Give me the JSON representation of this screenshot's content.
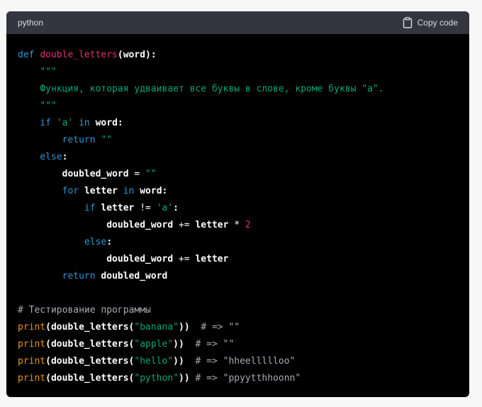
{
  "header": {
    "language": "python",
    "copy_label": "Copy code",
    "copy_icon": "clipboard-icon"
  },
  "colors": {
    "keyword": "#2e95d3",
    "function": "#df3079",
    "builtin": "#e9950c",
    "string": "#00a67d",
    "number": "#df3079",
    "comment": "#a9a9b3",
    "text": "#ffffff",
    "header_bg": "#343541",
    "code_bg": "#000000"
  },
  "code": {
    "lines": [
      [
        {
          "t": "kw",
          "v": "def"
        },
        {
          "t": "op",
          "v": " "
        },
        {
          "t": "fn",
          "v": "double_letters"
        },
        {
          "t": "id",
          "v": "(word):"
        }
      ],
      [
        {
          "t": "op",
          "v": "    "
        },
        {
          "t": "str",
          "v": "\"\"\""
        }
      ],
      [
        {
          "t": "op",
          "v": "    "
        },
        {
          "t": "str",
          "v": "Функция, которая удваивает все буквы в слове, кроме буквы \"а\"."
        }
      ],
      [
        {
          "t": "op",
          "v": "    "
        },
        {
          "t": "str",
          "v": "\"\"\""
        }
      ],
      [
        {
          "t": "op",
          "v": "    "
        },
        {
          "t": "kw",
          "v": "if"
        },
        {
          "t": "op",
          "v": " "
        },
        {
          "t": "str",
          "v": "'a'"
        },
        {
          "t": "op",
          "v": " "
        },
        {
          "t": "kw",
          "v": "in"
        },
        {
          "t": "op",
          "v": " "
        },
        {
          "t": "id",
          "v": "word:"
        }
      ],
      [
        {
          "t": "op",
          "v": "        "
        },
        {
          "t": "kw",
          "v": "return"
        },
        {
          "t": "op",
          "v": " "
        },
        {
          "t": "str",
          "v": "\"\""
        }
      ],
      [
        {
          "t": "op",
          "v": "    "
        },
        {
          "t": "kw",
          "v": "else"
        },
        {
          "t": "id",
          "v": ":"
        }
      ],
      [
        {
          "t": "op",
          "v": "        "
        },
        {
          "t": "id",
          "v": "doubled_word"
        },
        {
          "t": "op",
          "v": " = "
        },
        {
          "t": "str",
          "v": "\"\""
        }
      ],
      [
        {
          "t": "op",
          "v": "        "
        },
        {
          "t": "kw",
          "v": "for"
        },
        {
          "t": "op",
          "v": " "
        },
        {
          "t": "id",
          "v": "letter"
        },
        {
          "t": "op",
          "v": " "
        },
        {
          "t": "kw",
          "v": "in"
        },
        {
          "t": "op",
          "v": " "
        },
        {
          "t": "id",
          "v": "word:"
        }
      ],
      [
        {
          "t": "op",
          "v": "            "
        },
        {
          "t": "kw",
          "v": "if"
        },
        {
          "t": "op",
          "v": " "
        },
        {
          "t": "id",
          "v": "letter"
        },
        {
          "t": "op",
          "v": " != "
        },
        {
          "t": "str",
          "v": "'a'"
        },
        {
          "t": "id",
          "v": ":"
        }
      ],
      [
        {
          "t": "op",
          "v": "                "
        },
        {
          "t": "id",
          "v": "doubled_word"
        },
        {
          "t": "op",
          "v": " += "
        },
        {
          "t": "id",
          "v": "letter"
        },
        {
          "t": "op",
          "v": " * "
        },
        {
          "t": "num",
          "v": "2"
        }
      ],
      [
        {
          "t": "op",
          "v": "            "
        },
        {
          "t": "kw",
          "v": "else"
        },
        {
          "t": "id",
          "v": ":"
        }
      ],
      [
        {
          "t": "op",
          "v": "                "
        },
        {
          "t": "id",
          "v": "doubled_word"
        },
        {
          "t": "op",
          "v": " += "
        },
        {
          "t": "id",
          "v": "letter"
        }
      ],
      [
        {
          "t": "op",
          "v": "        "
        },
        {
          "t": "kw",
          "v": "return"
        },
        {
          "t": "op",
          "v": " "
        },
        {
          "t": "id",
          "v": "doubled_word"
        }
      ],
      [],
      [
        {
          "t": "cm",
          "v": "# Тестирование программы"
        }
      ],
      [
        {
          "t": "builtin",
          "v": "print"
        },
        {
          "t": "id",
          "v": "(double_letters("
        },
        {
          "t": "str",
          "v": "\"banana\""
        },
        {
          "t": "id",
          "v": "))"
        },
        {
          "t": "op",
          "v": "  "
        },
        {
          "t": "cm",
          "v": "# => \"\""
        }
      ],
      [
        {
          "t": "builtin",
          "v": "print"
        },
        {
          "t": "id",
          "v": "(double_letters("
        },
        {
          "t": "str",
          "v": "\"apple\""
        },
        {
          "t": "id",
          "v": "))"
        },
        {
          "t": "op",
          "v": "  "
        },
        {
          "t": "cm",
          "v": "# => \"\""
        }
      ],
      [
        {
          "t": "builtin",
          "v": "print"
        },
        {
          "t": "id",
          "v": "(double_letters("
        },
        {
          "t": "str",
          "v": "\"hello\""
        },
        {
          "t": "id",
          "v": "))"
        },
        {
          "t": "op",
          "v": "  "
        },
        {
          "t": "cm",
          "v": "# => \"hheellllloo\""
        }
      ],
      [
        {
          "t": "builtin",
          "v": "print"
        },
        {
          "t": "id",
          "v": "(double_letters("
        },
        {
          "t": "str",
          "v": "\"python\""
        },
        {
          "t": "id",
          "v": "))"
        },
        {
          "t": "op",
          "v": " "
        },
        {
          "t": "cm",
          "v": "# => \"ppyytthhoonn\""
        }
      ]
    ]
  }
}
